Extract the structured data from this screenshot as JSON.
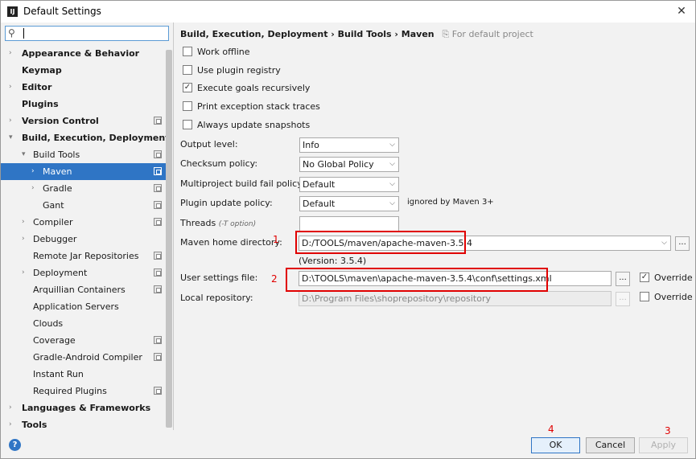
{
  "window": {
    "title": "Default Settings",
    "app_icon": "IJ",
    "close": "✕"
  },
  "search": {
    "value": ""
  },
  "tree": [
    {
      "label": "Appearance & Behavior",
      "bold": true,
      "arrow": "›",
      "level": 0
    },
    {
      "label": "Keymap",
      "bold": true,
      "arrow": "",
      "level": 0
    },
    {
      "label": "Editor",
      "bold": true,
      "arrow": "›",
      "level": 0
    },
    {
      "label": "Plugins",
      "bold": true,
      "arrow": "",
      "level": 0
    },
    {
      "label": "Version Control",
      "bold": true,
      "arrow": "›",
      "level": 0,
      "copy": true
    },
    {
      "label": "Build, Execution, Deployment",
      "bold": true,
      "arrow": "⌄",
      "level": 0
    },
    {
      "label": "Build Tools",
      "bold": false,
      "arrow": "⌄",
      "level": 1,
      "copy": true
    },
    {
      "label": "Maven",
      "bold": false,
      "arrow": "›",
      "level": 2,
      "copy": true,
      "selected": true
    },
    {
      "label": "Gradle",
      "bold": false,
      "arrow": "›",
      "level": 2,
      "copy": true
    },
    {
      "label": "Gant",
      "bold": false,
      "arrow": "",
      "level": 2,
      "copy": true
    },
    {
      "label": "Compiler",
      "bold": false,
      "arrow": "›",
      "level": 1,
      "copy": true
    },
    {
      "label": "Debugger",
      "bold": false,
      "arrow": "›",
      "level": 1
    },
    {
      "label": "Remote Jar Repositories",
      "bold": false,
      "arrow": "",
      "level": 1,
      "copy": true
    },
    {
      "label": "Deployment",
      "bold": false,
      "arrow": "›",
      "level": 1,
      "copy": true
    },
    {
      "label": "Arquillian Containers",
      "bold": false,
      "arrow": "",
      "level": 1,
      "copy": true
    },
    {
      "label": "Application Servers",
      "bold": false,
      "arrow": "",
      "level": 1
    },
    {
      "label": "Clouds",
      "bold": false,
      "arrow": "",
      "level": 1
    },
    {
      "label": "Coverage",
      "bold": false,
      "arrow": "",
      "level": 1,
      "copy": true
    },
    {
      "label": "Gradle-Android Compiler",
      "bold": false,
      "arrow": "",
      "level": 1,
      "copy": true
    },
    {
      "label": "Instant Run",
      "bold": false,
      "arrow": "",
      "level": 1
    },
    {
      "label": "Required Plugins",
      "bold": false,
      "arrow": "",
      "level": 1,
      "copy": true
    },
    {
      "label": "Languages & Frameworks",
      "bold": true,
      "arrow": "›",
      "level": 0
    },
    {
      "label": "Tools",
      "bold": true,
      "arrow": "›",
      "level": 0
    }
  ],
  "breadcrumb": {
    "path": "Build, Execution, Deployment › Build Tools › Maven",
    "hint": "For default project"
  },
  "checkboxes": [
    {
      "label": "Work offline",
      "checked": false
    },
    {
      "label": "Use plugin registry",
      "checked": false
    },
    {
      "label": "Execute goals recursively",
      "checked": true
    },
    {
      "label": "Print exception stack traces",
      "checked": false
    },
    {
      "label": "Always update snapshots",
      "checked": false
    }
  ],
  "form": {
    "output_level_label": "Output level:",
    "output_level_value": "Info",
    "checksum_label": "Checksum policy:",
    "checksum_value": "No Global Policy",
    "multiproject_label": "Multiproject build fail policy:",
    "multiproject_value": "Default",
    "plugin_update_label": "Plugin update policy:",
    "plugin_update_value": "Default",
    "plugin_update_note": "ignored by Maven 3+",
    "threads_label": "Threads",
    "threads_hint": "(-T option)",
    "threads_value": "",
    "home_label": "Maven home directory:",
    "home_value": "D:/TOOLS/maven/apache-maven-3.5.4",
    "home_version": "(Version: 3.5.4)",
    "settings_label": "User settings file:",
    "settings_value": "D:\\TOOLS\\maven\\apache-maven-3.5.4\\conf\\settings.xml",
    "settings_override_label": "Override",
    "settings_override_checked": true,
    "repo_label": "Local repository:",
    "repo_value": "D:\\Program Files\\shoprepository\\repository",
    "repo_override_label": "Override",
    "repo_override_checked": false,
    "browse_label": "..."
  },
  "annotations": {
    "n1": "1",
    "n2": "2",
    "n3": "3",
    "n4": "4",
    "color": "#e00000"
  },
  "buttons": {
    "ok": "OK",
    "cancel": "Cancel",
    "apply": "Apply",
    "help": "?"
  },
  "colors": {
    "selection": "#2f75c5",
    "accent_red": "#e00000"
  }
}
